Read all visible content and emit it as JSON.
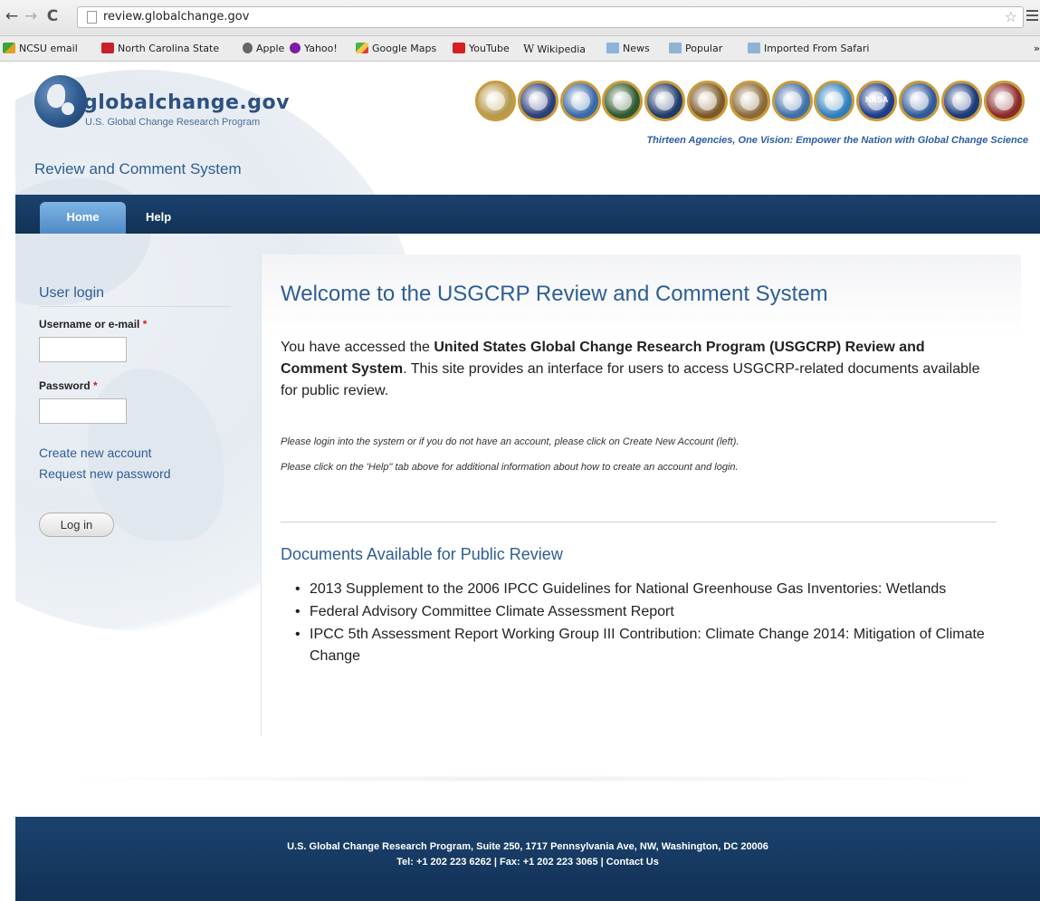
{
  "browser": {
    "url": "review.globalchange.gov",
    "bookmarks": [
      "NCSU email",
      "North Carolina State",
      "Apple",
      "Yahoo!",
      "Google Maps",
      "YouTube",
      "Wikipedia",
      "News",
      "Popular",
      "Imported From Safari"
    ],
    "more": "»"
  },
  "header": {
    "logo_title": "globalchange.gov",
    "logo_subtitle": "U.S. Global Change Research Program",
    "site_name": "Review and Comment System",
    "tagline": "Thirteen Agencies, One Vision: Empower the Nation with Global Change Science",
    "seal_colors": [
      "#b59a4e",
      "#2b3f7a",
      "#3a6aa8",
      "#2f5a2f",
      "#1f3a6a",
      "#7b5a2a",
      "#8a6a3a",
      "#3f6fa8",
      "#2f7fbf",
      "#1d3d8a",
      "#2f5a9a",
      "#1a3a7a",
      "#8a2a2a"
    ],
    "nasa_label": "NASA"
  },
  "nav": {
    "home": "Home",
    "help": "Help"
  },
  "sidebar": {
    "title": "User login",
    "username_label": "Username or e-mail",
    "password_label": "Password",
    "required_mark": "*",
    "create_account": "Create new account",
    "request_password": "Request new password",
    "login_button": "Log in"
  },
  "main": {
    "title": "Welcome to the USGCRP Review and Comment System",
    "intro_prefix": "You have accessed the ",
    "intro_bold": "United States Global Change Research Program (USGCRP) Review and Comment System",
    "intro_suffix": ". This site provides an interface for users to access USGCRP-related documents available for public review.",
    "note1": "Please login into the system or if you do not have an account, please click on Create New Account (left).",
    "note2": "Please click on the 'Help\" tab above for additional information about how to create an account and login.",
    "docs_title": "Documents Available for Public Review",
    "documents": [
      "2013 Supplement to the 2006 IPCC Guidelines for National Greenhouse Gas Inventories: Wetlands",
      "Federal Advisory Committee Climate Assessment Report",
      "IPCC 5th Assessment Report Working Group III Contribution: Climate Change 2014: Mitigation of Climate Change"
    ]
  },
  "footer": {
    "address": "U.S. Global Change Research Program, Suite 250, 1717 Pennsylvania Ave, NW, Washington, DC 20006",
    "contact_prefix": "Tel: +1 202 223 6262  | Fax: +1 202 223 3065 | ",
    "contact_link": "Contact Us"
  }
}
